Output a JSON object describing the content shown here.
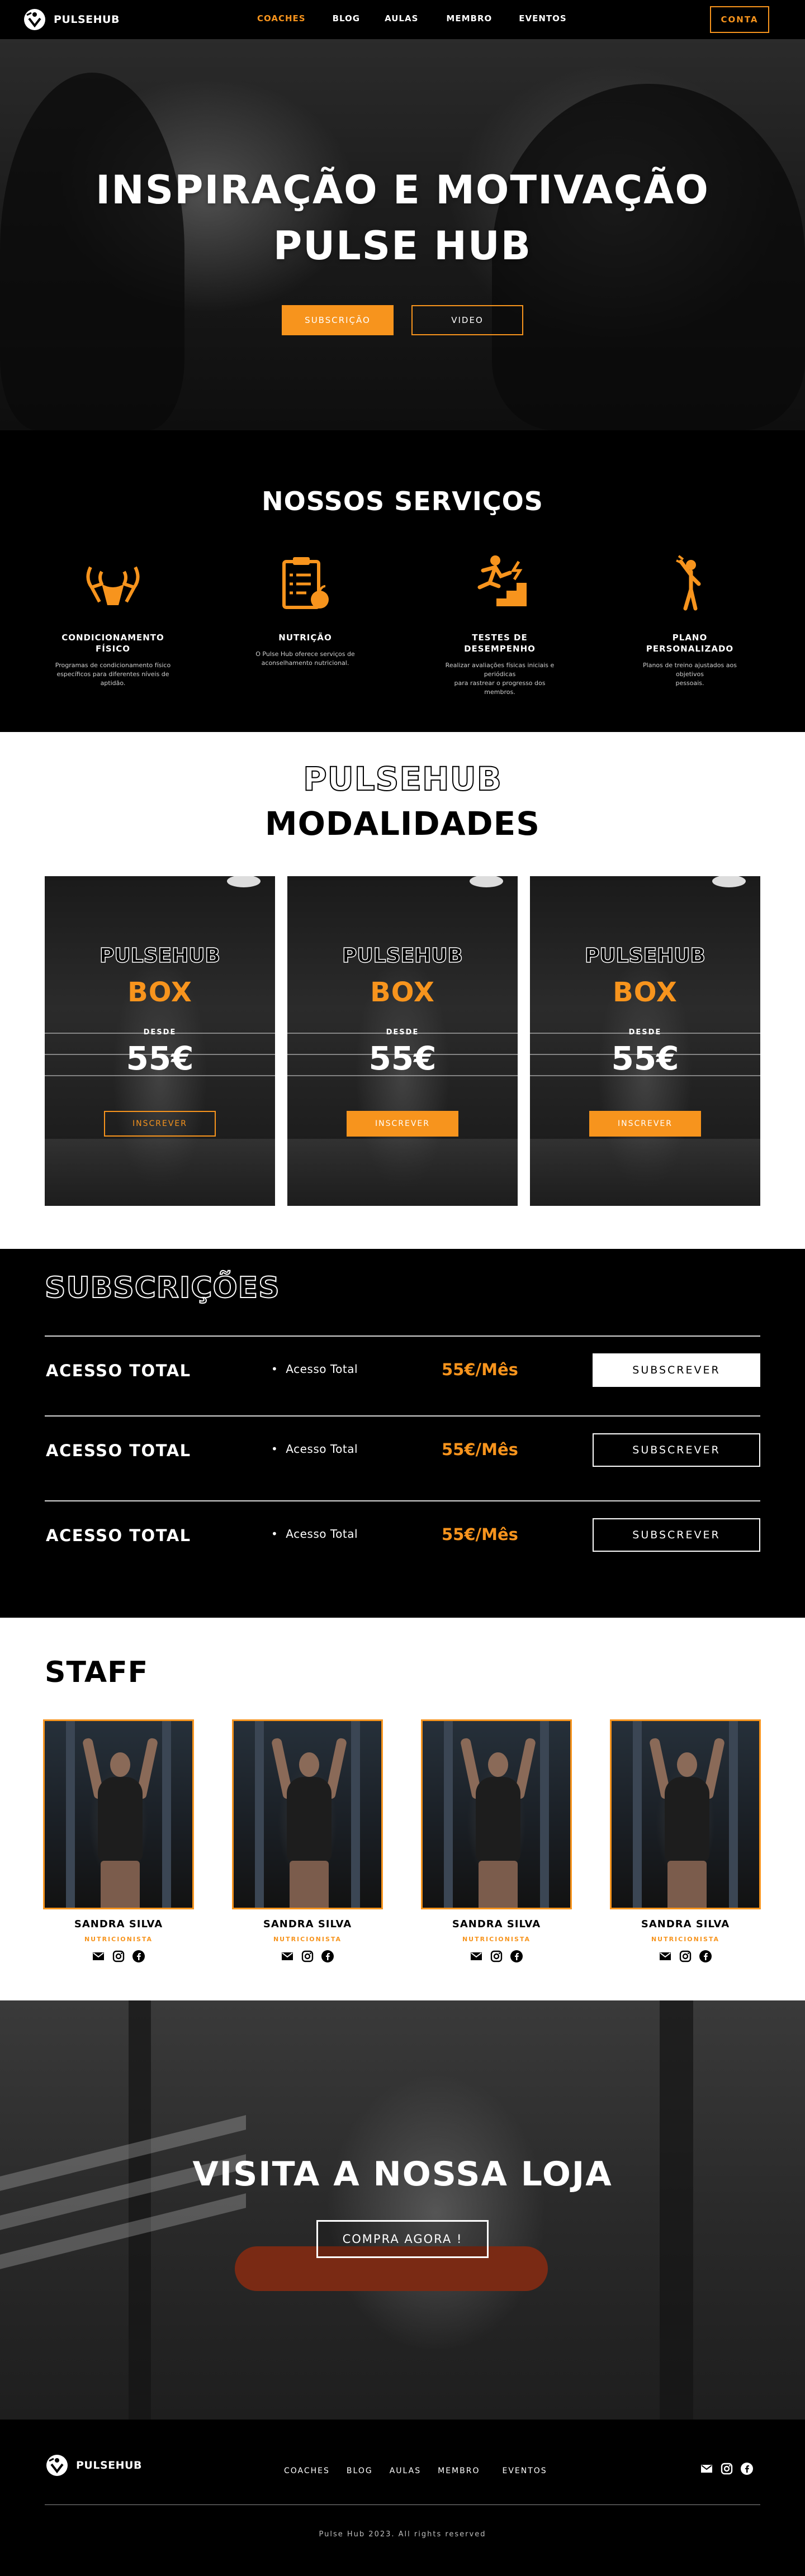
{
  "colors": {
    "accent": "#f7941d",
    "dark": "#000000",
    "light": "#ffffff"
  },
  "brand": {
    "name": "PULSEHUB",
    "logo_icon": "runner-heart-icon"
  },
  "nav": {
    "items": [
      "COACHES",
      "BLOG",
      "AULAS",
      "MEMBRO",
      "EVENTOS"
    ],
    "active": "COACHES",
    "account_label": "CONTA"
  },
  "hero": {
    "title_line1": "INSPIRAÇÃO E MOTIVAÇÃO",
    "title_line2": "PULSE HUB",
    "primary_cta": "SUBSCRIÇÃO",
    "secondary_cta": "VIDEO"
  },
  "services": {
    "title": "NOSSOS SERVIÇOS",
    "items": [
      {
        "icon": "muscle-arms-icon",
        "name_line1": "CONDICIONAMENTO",
        "name_line2": "FÍSICO",
        "desc_line1": "Programas de condicionamento físico",
        "desc_line2": "específicos para diferentes níveis de aptidão."
      },
      {
        "icon": "nutrition-clipboard-apple-icon",
        "name_line1": "NUTRIÇÃO",
        "name_line2": "",
        "desc_line1": "O Pulse Hub oferece serviços de",
        "desc_line2": "aconselhamento nutricional."
      },
      {
        "icon": "performance-stairs-icon",
        "name_line1": "TESTES DE",
        "name_line2": "DESEMPENHO",
        "desc_line1": "Realizar avaliações físicas iniciais e periódicas",
        "desc_line2": "para rastrear o progresso dos membros."
      },
      {
        "icon": "trainer-figure-icon",
        "name_line1": "PLANO",
        "name_line2": "PERSONALIZADO",
        "desc_line1": "Planos de treino ajustados aos objetivos",
        "desc_line2": "pessoais."
      }
    ]
  },
  "modalidades": {
    "brand": "PULSEHUB",
    "title": "MODALIDADES",
    "cards": [
      {
        "brand": "PULSEHUB",
        "name": "BOX",
        "from_label": "DESDE",
        "price": "55€",
        "cta": "INSCREVER"
      },
      {
        "brand": "PULSEHUB",
        "name": "BOX",
        "from_label": "DESDE",
        "price": "55€",
        "cta": "INSCREVER"
      },
      {
        "brand": "PULSEHUB",
        "name": "BOX",
        "from_label": "DESDE",
        "price": "55€",
        "cta": "INSCREVER"
      }
    ]
  },
  "subscriptions": {
    "title": "SUBSCRIÇÕES",
    "plans": [
      {
        "name": "ACESSO TOTAL",
        "feature": "Acesso Total",
        "price": "55€/Mês",
        "cta": "SUBSCREVER",
        "style": "solid"
      },
      {
        "name": "ACESSO TOTAL",
        "feature": "Acesso Total",
        "price": "55€/Mês",
        "cta": "SUBSCREVER",
        "style": "ghost"
      },
      {
        "name": "ACESSO TOTAL",
        "feature": "Acesso Total",
        "price": "55€/Mês",
        "cta": "SUBSCREVER",
        "style": "ghost"
      }
    ]
  },
  "staff": {
    "title": "STAFF",
    "members": [
      {
        "name": "SANDRA SILVA",
        "role": "NUTRICIONISTA"
      },
      {
        "name": "SANDRA SILVA",
        "role": "NUTRICIONISTA"
      },
      {
        "name": "SANDRA SILVA",
        "role": "NUTRICIONISTA"
      },
      {
        "name": "SANDRA SILVA",
        "role": "NUTRICIONISTA"
      }
    ],
    "social_icons": [
      "email-icon",
      "instagram-icon",
      "facebook-icon"
    ]
  },
  "store": {
    "title": "VISITA A NOSSA LOJA",
    "cta": "COMPRA AGORA !"
  },
  "footer": {
    "brand": "PULSEHUB",
    "links": [
      "COACHES",
      "BLOG",
      "AULAS",
      "MEMBRO",
      "EVENTOS"
    ],
    "social_icons": [
      "email-icon",
      "instagram-icon",
      "facebook-icon"
    ],
    "copyright": "Pulse Hub 2023. All rights reserved"
  }
}
